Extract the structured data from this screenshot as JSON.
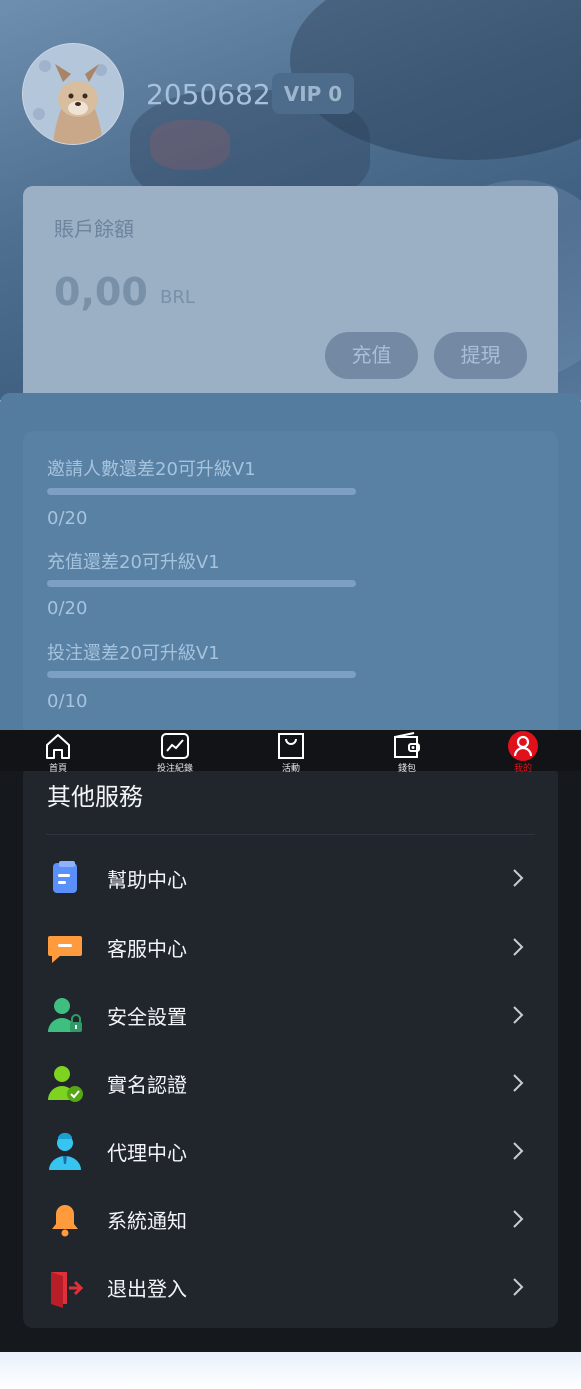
{
  "profile": {
    "user_id": "2050682",
    "vip_level": "VIP 0",
    "avatar_icon": "dog-avatar"
  },
  "balance": {
    "label": "賬戶餘額",
    "amount": "0,00",
    "currency": "BRL",
    "deposit_label": "充值",
    "withdraw_label": "提現"
  },
  "vip_requirements": [
    {
      "label": "邀請人數還差20可升級V1",
      "count": "0/20",
      "progress": 0
    },
    {
      "label": "充值還差20可升級V1",
      "count": "0/20",
      "progress": 0
    },
    {
      "label": "投注還差20可升級V1",
      "count": "0/10",
      "progress": 0
    }
  ],
  "tabbar": {
    "items": [
      {
        "label": "首頁",
        "icon": "home-icon"
      },
      {
        "label": "投注紀錄",
        "icon": "chart-icon"
      },
      {
        "label": "活動",
        "icon": "bag-icon"
      },
      {
        "label": "錢包",
        "icon": "wallet-icon"
      },
      {
        "label": "我的",
        "icon": "user-icon",
        "active": true
      }
    ],
    "active_color": "#e0111b"
  },
  "services": {
    "title": "其他服務",
    "items": [
      {
        "label": "幫助中心",
        "icon": "document-icon"
      },
      {
        "label": "客服中心",
        "icon": "chat-icon"
      },
      {
        "label": "安全設置",
        "icon": "user-lock-icon"
      },
      {
        "label": "實名認證",
        "icon": "user-verified-icon"
      },
      {
        "label": "代理中心",
        "icon": "agent-icon"
      },
      {
        "label": "系統通知",
        "icon": "bell-icon"
      },
      {
        "label": "退出登入",
        "icon": "logout-icon"
      }
    ]
  }
}
